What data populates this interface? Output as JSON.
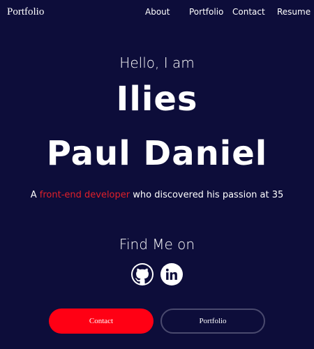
{
  "nav": {
    "brand": "Portfolio",
    "links": [
      "About",
      "Portfolio",
      "Contact",
      "Resume"
    ]
  },
  "hero": {
    "greeting": "Hello, I am",
    "name_line1": "Ilies",
    "name_line2": "Paul Daniel",
    "tagline_prefix": "A ",
    "tagline_highlight": "front-end developer",
    "tagline_suffix": " who discovered his passion at 35"
  },
  "find": {
    "title": "Find Me on",
    "icons": [
      "github-icon",
      "linkedin-icon"
    ]
  },
  "buttons": {
    "contact": "Contact",
    "portfolio": "Portfolio"
  },
  "colors": {
    "background": "#0d0d3a",
    "accent": "#e0202a",
    "primary_button": "#ff0014"
  }
}
